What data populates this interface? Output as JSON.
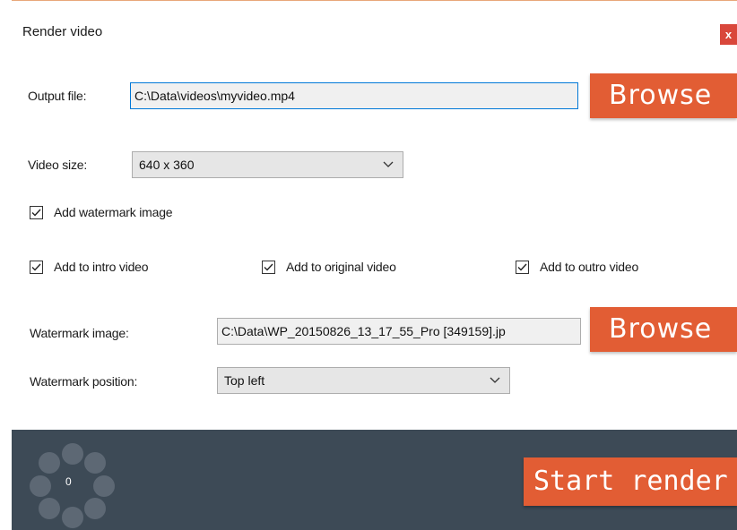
{
  "window": {
    "title": "Render video",
    "close_label": "x"
  },
  "output": {
    "label": "Output file:",
    "value": "C:\\Data\\videos\\myvideo.mp4",
    "browse_label": "Browse"
  },
  "video_size": {
    "label": "Video size:",
    "value": "640 x 360"
  },
  "watermark": {
    "enable_label": "Add watermark image",
    "enable_checked": true,
    "targets": [
      {
        "label": "Add to intro video",
        "checked": true
      },
      {
        "label": "Add to original video",
        "checked": true
      },
      {
        "label": "Add to outro video",
        "checked": true
      }
    ],
    "image_label": "Watermark image:",
    "image_value": "C:\\Data\\WP_20150826_13_17_55_Pro [349159].jp",
    "browse_label": "Browse",
    "position_label": "Watermark position:",
    "position_value": "Top left"
  },
  "footer": {
    "progress": "0",
    "start_label": "Start render"
  },
  "colors": {
    "accent": "#e25d34",
    "footer_bg": "#3d4a56",
    "close_bg": "#d9473b"
  },
  "icons": {
    "close": "close-icon",
    "dropdown": "chevron-down-icon",
    "check": "check-icon",
    "spinner": "loading-spinner-icon"
  }
}
